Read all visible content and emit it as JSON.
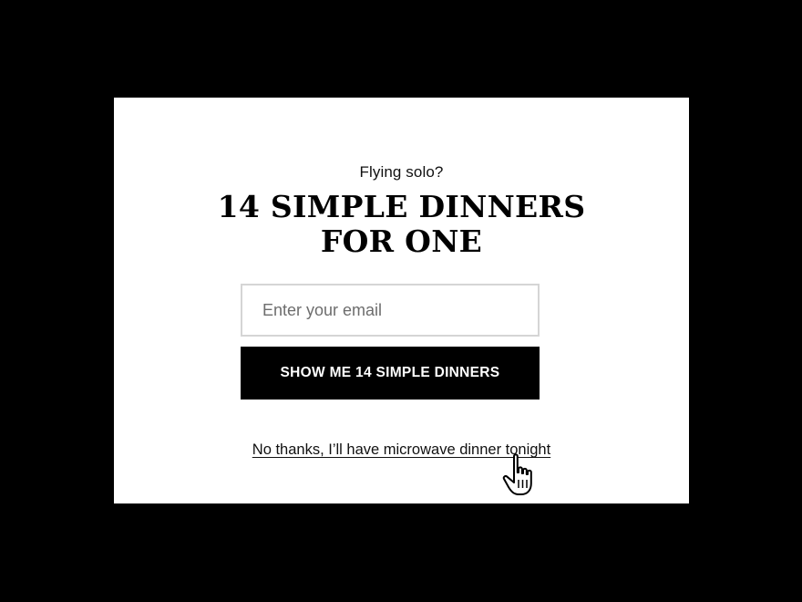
{
  "modal": {
    "eyebrow": "Flying solo?",
    "headline_line1": "14 SIMPLE DINNERS",
    "headline_line2": "FOR ONE",
    "email_placeholder": "Enter your email",
    "email_value": "",
    "cta_label": "SHOW ME 14 SIMPLE DINNERS",
    "decline_label": "No thanks, I’ll have microwave dinner tonight"
  },
  "cursor": {
    "icon": "hand-pointer-icon"
  },
  "colors": {
    "backdrop": "#000000",
    "modal_bg": "#ffffff",
    "button_bg": "#000000",
    "button_text": "#ffffff",
    "input_border": "#d5d5d5"
  }
}
